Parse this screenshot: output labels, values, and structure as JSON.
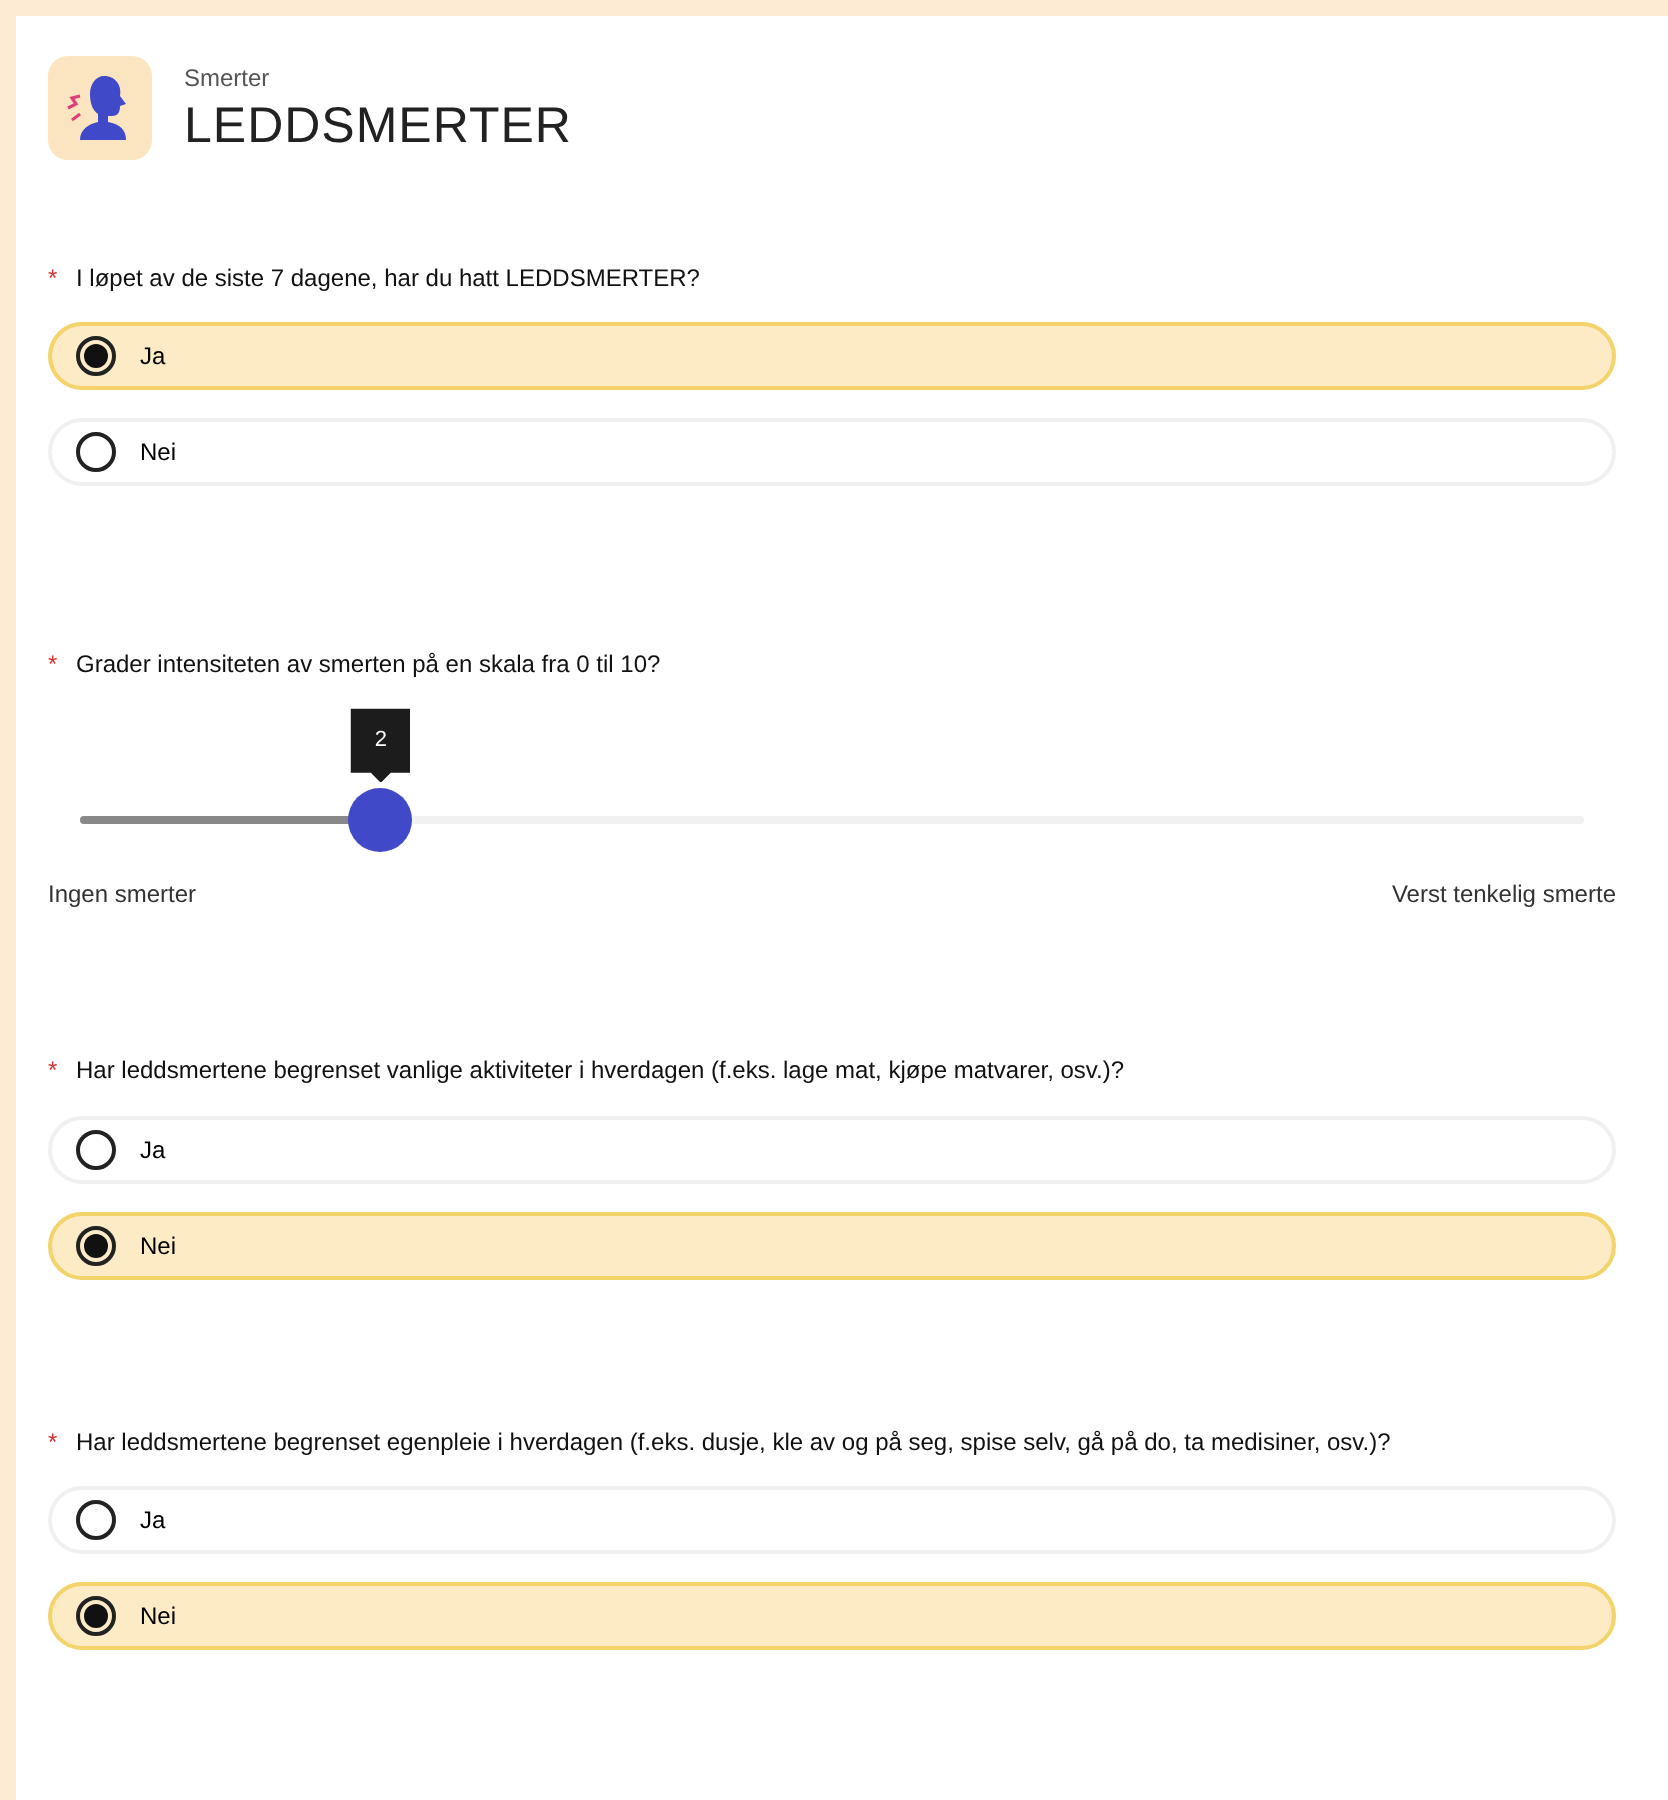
{
  "header": {
    "category": "Smerter",
    "title": "LEDDSMERTER"
  },
  "questions": [
    {
      "kind": "radio",
      "marker": "*",
      "text": "I løpet av de siste 7 dagene, har du hatt LEDDSMERTER?",
      "options": [
        {
          "label": "Ja",
          "selected": true
        },
        {
          "label": "Nei",
          "selected": false
        }
      ]
    },
    {
      "kind": "slider",
      "marker": "*",
      "text": "Grader intensiteten av smerten på en skala fra 0 til 10?",
      "value": "2",
      "level": 0.2,
      "min_label": "Ingen smerter",
      "max_label": "Verst tenkelig smerte"
    },
    {
      "kind": "radio",
      "marker": "*",
      "text": "Har leddsmertene begrenset vanlige aktiviteter i hverdagen (f.eks. lage mat, kjøpe matvarer, osv.)?",
      "options": [
        {
          "label": "Ja",
          "selected": false
        },
        {
          "label": "Nei",
          "selected": true
        }
      ]
    },
    {
      "kind": "radio",
      "marker": "*",
      "text": "Har leddsmertene begrenset egenpleie i hverdagen (f.eks. dusje, kle av og på seg, spise selv, gå på do, ta medisiner, osv.)?",
      "options": [
        {
          "label": "Ja",
          "selected": false
        },
        {
          "label": "Nei",
          "selected": true
        }
      ]
    }
  ]
}
